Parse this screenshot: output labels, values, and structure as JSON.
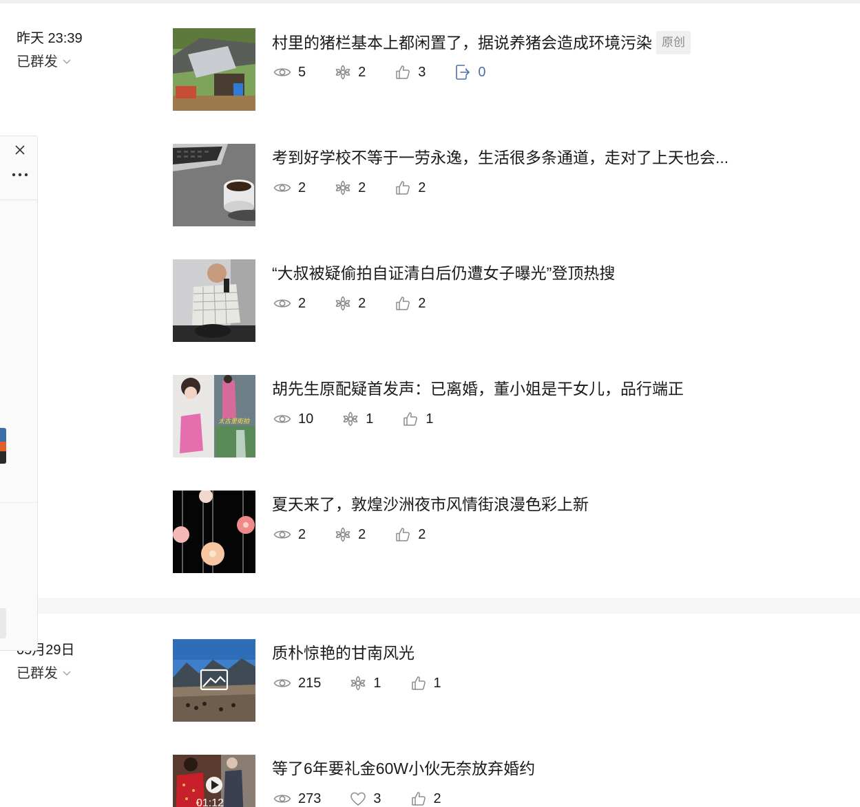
{
  "groups": [
    {
      "date": "昨天 23:39",
      "status": "已群发",
      "articles": [
        {
          "title": "村里的猪栏基本上都闲置了，据说养猪会造成环境污染",
          "badge": "原创",
          "views": "5",
          "shares_wechat": "2",
          "likes": "3",
          "forwards": "0"
        },
        {
          "title": "考到好学校不等于一劳永逸，生活很多条通道，走对了上天也会...",
          "views": "2",
          "shares_wechat": "2",
          "likes": "2"
        },
        {
          "title": "“大叔被疑偷拍自证清白后仍遭女子曝光”登顶热搜",
          "views": "2",
          "shares_wechat": "2",
          "likes": "2"
        },
        {
          "title": "胡先生原配疑首发声：已离婚，董小姐是干女儿，品行端正",
          "views": "10",
          "shares_wechat": "1",
          "likes": "1"
        },
        {
          "title": "夏天来了，敦煌沙洲夜市风情街浪漫色彩上新",
          "views": "2",
          "shares_wechat": "2",
          "likes": "2"
        }
      ]
    },
    {
      "date": "05月29日",
      "status": "已群发",
      "articles": [
        {
          "title": "质朴惊艳的甘南风光",
          "views": "215",
          "shares_wechat": "1",
          "likes": "1"
        },
        {
          "title": "等了6年要礼金60W小伙无奈放弃婚约",
          "views": "273",
          "hearts": "3",
          "likes": "2",
          "video_duration": "01:12"
        }
      ]
    }
  ],
  "thumb_text": {
    "a4_caption": "太古里街拍"
  },
  "colors": {
    "accent": "#4a6ea9",
    "icon_gray": "#8c8c8c",
    "badge_bg": "#f0f0f0"
  },
  "icons": [
    "eye-icon",
    "wechat-share-icon",
    "thumbs-up-icon",
    "forward-icon",
    "heart-icon",
    "chevron-down-icon",
    "close-icon",
    "more-icon",
    "play-icon",
    "image-placeholder-icon"
  ]
}
